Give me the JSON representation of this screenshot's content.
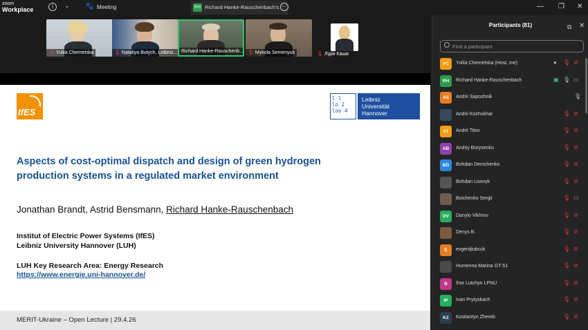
{
  "titlebar": {
    "app_line1": "zoom",
    "app_line2": "Workplace",
    "meeting_label": "Meeting",
    "tab_badge": "RH",
    "tab_title": "Richard Hanke-Rauschenbach's s",
    "controls": [
      "—",
      "❐",
      "✕"
    ]
  },
  "gallery": [
    {
      "name": "Yuliia Chernetska",
      "muted": true
    },
    {
      "name": "Nataliya Butych, Leibniz...",
      "muted": true
    },
    {
      "name": "Richard Hanke-Rauschenb...",
      "muted": false
    },
    {
      "name": "Mykola Semenyuk",
      "muted": true
    },
    {
      "name": "Лідія Каша",
      "muted": true
    }
  ],
  "slide": {
    "ifes_logo": "IfES",
    "luh_logo_grid": "l l\nlo 2\nloo 4",
    "luh_logo_name": [
      "Leibniz",
      "Universität",
      "Hannover"
    ],
    "title_line1": "Aspects of cost-optimal dispatch and design of green hydrogen",
    "title_line2": "production systems in a regulated market environment",
    "authors_plain": "Jonathan Brandt, Astrid Bensmann, ",
    "authors_underlined": "Richard Hanke-Rauschenbach",
    "institute_line1": "Institut of Electric Power Systems (IfES)",
    "institute_line2": "Leibniz University Hannover (LUH)",
    "key_area": "LUH Key Research Area: Energy Research",
    "link": "https://www.energie.uni-hannover.de/",
    "footer": "MERIT-Ukraine – Open Lecture | 29.4.26"
  },
  "participants_panel": {
    "title": "Participants (81)",
    "search_placeholder": "Find a participant",
    "rows": [
      {
        "initials": "YC",
        "color": "#f39c12",
        "name": "Yuliia Chernetska (Host, me)",
        "mic": "muted",
        "video": "off",
        "dot": true
      },
      {
        "initials": "RH",
        "color": "#2e9a4e",
        "name": "Richard Hanke-Rauschenbach",
        "mic": "on",
        "video": "on",
        "share": true
      },
      {
        "initials": "AS",
        "color": "#e67e22",
        "name": "Andrii Sapozhnik",
        "mic": "on-gray",
        "video": "none"
      },
      {
        "initials": "",
        "color": "#34495e",
        "name": "Andrii Kozhukhar",
        "mic": "muted",
        "video": "off",
        "photo": true
      },
      {
        "initials": "AT",
        "color": "#f39c12",
        "name": "Andrii Titov",
        "mic": "muted",
        "video": "off"
      },
      {
        "initials": "AB",
        "color": "#8e44ad",
        "name": "Andriy Borysenko",
        "mic": "muted",
        "video": "off"
      },
      {
        "initials": "BD",
        "color": "#2e86de",
        "name": "Bohdan Demchenko",
        "mic": "muted",
        "video": "off"
      },
      {
        "initials": "",
        "color": "#555",
        "name": "Bohdan Lisovyk",
        "mic": "muted",
        "video": "off",
        "photo": true
      },
      {
        "initials": "",
        "color": "#6d5d50",
        "name": "Boichenko Sergii",
        "mic": "muted",
        "video": "on-gray",
        "photo": true
      },
      {
        "initials": "DV",
        "color": "#27ae60",
        "name": "Danylo Vikhrov",
        "mic": "muted",
        "video": "off"
      },
      {
        "initials": "",
        "color": "#7a5a40",
        "name": "Denys B.",
        "mic": "muted",
        "video": "off",
        "photo": true
      },
      {
        "initials": "E",
        "color": "#e67e22",
        "name": "evgenijlubcuk",
        "mic": "muted",
        "video": "off"
      },
      {
        "initials": "",
        "color": "#4a4a4a",
        "name": "Humenna Marina GT-51",
        "mic": "muted",
        "video": "off",
        "photo": true
      },
      {
        "initials": "B",
        "color": "#c0398a",
        "name": "Ihor Lutchyn LPNU",
        "mic": "muted",
        "video": "off"
      },
      {
        "initials": "IP",
        "color": "#27ae60",
        "name": "Ivan Prytyskach",
        "mic": "muted",
        "video": "off"
      },
      {
        "initials": "KZ",
        "color": "#2c3e50",
        "name": "Kostiantyn Zhereb",
        "mic": "muted",
        "video": "off"
      }
    ]
  },
  "colors": {
    "accent": "#1a5296",
    "muted_red": "#e23b3b",
    "active_green": "#33c46a"
  }
}
